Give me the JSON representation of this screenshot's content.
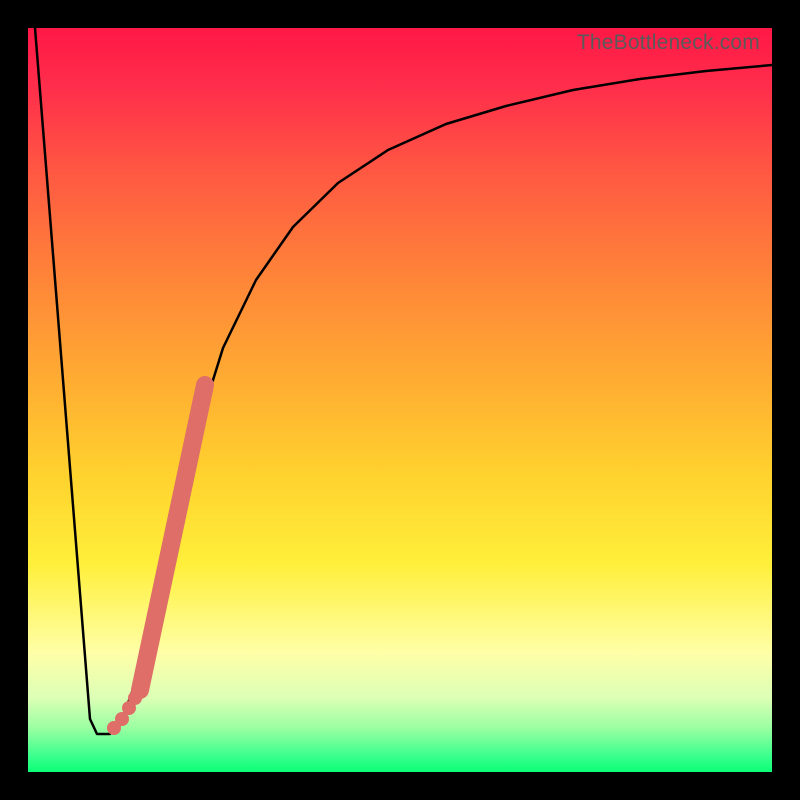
{
  "watermark": "TheBottleneck.com",
  "colors": {
    "frame": "#000000",
    "highlight": "#de6e67",
    "line": "#000000",
    "gradient": [
      "#ff1846",
      "#ff2e4b",
      "#ff5a42",
      "#ff8638",
      "#ffae32",
      "#ffd22e",
      "#ffef3a",
      "#ffffa7",
      "#dcffb6",
      "#9cffa2",
      "#37ff8c",
      "#0aff75"
    ]
  },
  "chart_data": {
    "type": "line",
    "title": "",
    "xlabel": "",
    "ylabel": "",
    "xlim": [
      0,
      100
    ],
    "ylim": [
      0,
      100
    ],
    "grid": false,
    "series": [
      {
        "name": "bottleneck-curve",
        "x": [
          0,
          8,
          9,
          10,
          12,
          15,
          18,
          22,
          26,
          30,
          35,
          41,
          48,
          56,
          64,
          73,
          82,
          91,
          100
        ],
        "y": [
          100,
          7,
          5,
          5,
          6,
          16,
          28,
          45,
          58,
          66,
          73,
          79,
          83.5,
          87,
          89.5,
          91.5,
          93,
          94,
          95
        ]
      }
    ],
    "highlight_segment": {
      "name": "dense-region",
      "x_range": [
        14.5,
        23.5
      ],
      "y_range": [
        10,
        52
      ]
    },
    "highlight_points": [
      {
        "x": 11.2,
        "y": 6
      },
      {
        "x": 12.4,
        "y": 8
      },
      {
        "x": 13.2,
        "y": 10
      },
      {
        "x": 14.0,
        "y": 12.5
      }
    ],
    "annotations": []
  }
}
